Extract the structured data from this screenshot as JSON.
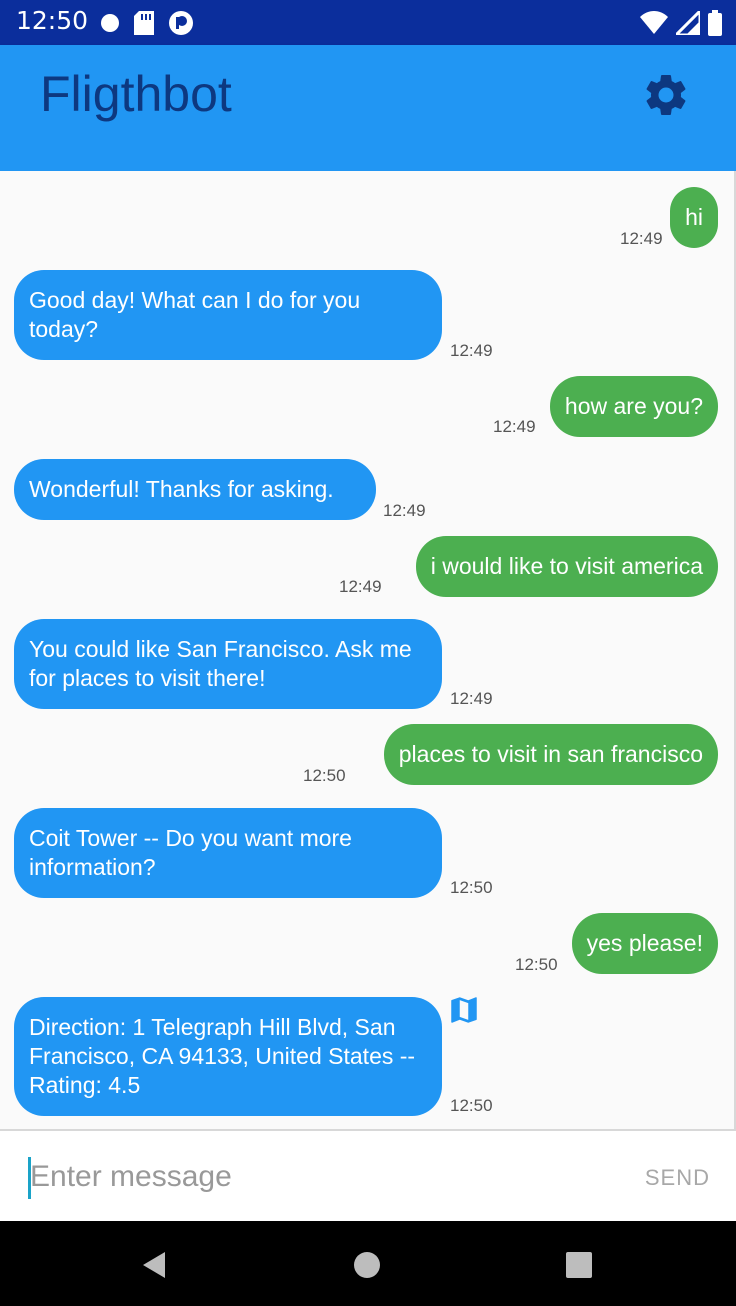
{
  "status_bar": {
    "time": "12:50",
    "left_icons": [
      "notification-dot-icon",
      "sd-card-icon",
      "app-badge-icon"
    ],
    "right_icons": [
      "wifi-icon",
      "signal-icon",
      "battery-icon"
    ]
  },
  "app_bar": {
    "title": "Fligthbot",
    "settings_icon": "gear-icon"
  },
  "colors": {
    "status_bar": "#0b2e9c",
    "app_bar": "#2196f3",
    "title_text": "#0d3880",
    "bot_bubble": "#2196f3",
    "user_bubble": "#4caf50"
  },
  "messages": [
    {
      "sender": "user",
      "text": "hi",
      "time": "12:49"
    },
    {
      "sender": "bot",
      "text": "Good day! What can I do for you today?",
      "time": "12:49"
    },
    {
      "sender": "user",
      "text": "how are you?",
      "time": "12:49"
    },
    {
      "sender": "bot",
      "text": "Wonderful! Thanks for asking.",
      "time": "12:49"
    },
    {
      "sender": "user",
      "text": "i would like to visit america",
      "time": "12:49"
    },
    {
      "sender": "bot",
      "text": "You could like San Francisco. Ask me for places to visit there!",
      "time": "12:49"
    },
    {
      "sender": "user",
      "text": "places to visit in san francisco",
      "time": "12:50"
    },
    {
      "sender": "bot",
      "text": "Coit Tower -- Do you want more information?",
      "time": "12:50"
    },
    {
      "sender": "user",
      "text": "yes please!",
      "time": "12:50"
    },
    {
      "sender": "bot",
      "text": "Direction: 1 Telegraph Hill Blvd, San Francisco, CA 94133, United States -- Rating: 4.5",
      "time": "12:50",
      "icon": "map-icon"
    }
  ],
  "input": {
    "value": "",
    "placeholder": "Enter message",
    "send_label": "SEND"
  },
  "nav_bar": {
    "icons": [
      "back-icon",
      "home-icon",
      "recents-icon"
    ]
  }
}
